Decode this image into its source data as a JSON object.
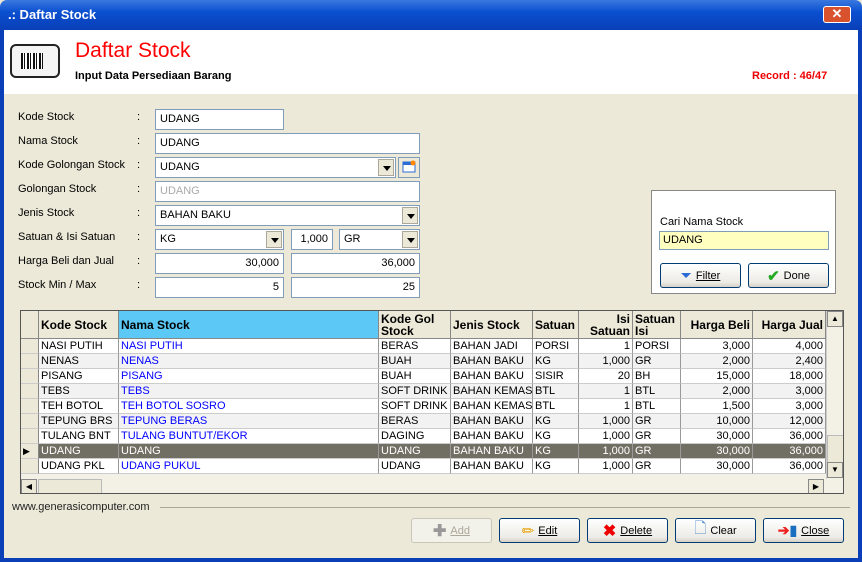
{
  "window": {
    "title": ".: Daftar Stock",
    "close_label": "✕"
  },
  "header": {
    "title": "Daftar Stock",
    "subtitle": "Input Data Persediaan Barang",
    "record": "Record : 46/47",
    "icon": "barcode-icon"
  },
  "form": {
    "kode_stock": {
      "label": "Kode Stock",
      "value": "UDANG"
    },
    "nama_stock": {
      "label": "Nama Stock",
      "value": "UDANG"
    },
    "kode_golongan": {
      "label": "Kode Golongan Stock",
      "value": "UDANG"
    },
    "golongan": {
      "label": "Golongan Stock",
      "value": "UDANG"
    },
    "jenis": {
      "label": "Jenis Stock",
      "value": "BAHAN BAKU"
    },
    "satuan": {
      "label": "Satuan & Isi Satuan",
      "satuan": "KG",
      "isi": "1,000",
      "satuan_isi": "GR"
    },
    "harga": {
      "label": "Harga Beli dan Jual",
      "beli": "30,000",
      "jual": "36,000"
    },
    "stock": {
      "label": "Stock Min / Max",
      "min": "5",
      "max": "25"
    },
    "colon": ":"
  },
  "search": {
    "label": "Cari Nama Stock",
    "value": "UDANG",
    "filter": "Filter",
    "done": "Done"
  },
  "grid": {
    "columns": [
      "Kode Stock",
      "Nama Stock",
      "Kode Gol Stock",
      "Jenis Stock",
      "Satuan",
      "Isi Satuan",
      "Satuan Isi",
      "Harga Beli",
      "Harga Jual"
    ],
    "selected_index": 7,
    "rows": [
      [
        "NASI PUTIH",
        "NASI PUTIH",
        "BERAS",
        "BAHAN JADI",
        "PORSI",
        "1",
        "PORSI",
        "3,000",
        "4,000"
      ],
      [
        "NENAS",
        "NENAS",
        "BUAH",
        "BAHAN BAKU",
        "KG",
        "1,000",
        "GR",
        "2,000",
        "2,400"
      ],
      [
        "PISANG",
        "PISANG",
        "BUAH",
        "BAHAN BAKU",
        "SISIR",
        "20",
        "BH",
        "15,000",
        "18,000"
      ],
      [
        "TEBS",
        "TEBS",
        "SOFT DRINK",
        "BAHAN KEMAS",
        "BTL",
        "1",
        "BTL",
        "2,000",
        "3,000"
      ],
      [
        "TEH BOTOL",
        "TEH BOTOL SOSRO",
        "SOFT DRINK",
        "BAHAN KEMAS",
        "BTL",
        "1",
        "BTL",
        "1,500",
        "3,000"
      ],
      [
        "TEPUNG BRS",
        "TEPUNG BERAS",
        "BERAS",
        "BAHAN BAKU",
        "KG",
        "1,000",
        "GR",
        "10,000",
        "12,000"
      ],
      [
        "TULANG BNT",
        "TULANG BUNTUT/EKOR",
        "DAGING",
        "BAHAN BAKU",
        "KG",
        "1,000",
        "GR",
        "30,000",
        "36,000"
      ],
      [
        "UDANG",
        "UDANG",
        "UDANG",
        "BAHAN BAKU",
        "KG",
        "1,000",
        "GR",
        "30,000",
        "36,000"
      ],
      [
        "UDANG PKL",
        "UDANG PUKUL",
        "UDANG",
        "BAHAN BAKU",
        "KG",
        "1,000",
        "GR",
        "30,000",
        "36,000"
      ]
    ]
  },
  "buttons": {
    "add": "Add",
    "edit": "Edit",
    "delete": "Delete",
    "clear": "Clear",
    "close": "Close"
  },
  "footer": {
    "website": "www.generasicomputer.com"
  },
  "colors": {
    "title_red": "#ff0000",
    "header_highlight": "#5bc8f5",
    "selected_row": "#716f64",
    "link_blue": "#0000ff"
  }
}
